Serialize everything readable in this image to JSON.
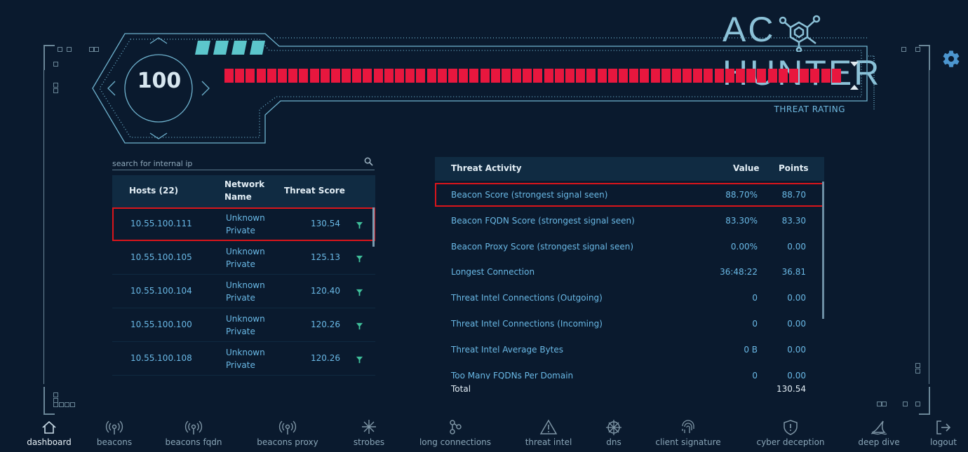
{
  "logo": {
    "left_text": "AC",
    "right_text": "HUNTER"
  },
  "gauge": {
    "value": "100",
    "label": "THREAT RATING",
    "level": 1.0
  },
  "search": {
    "placeholder": "search for internal ip"
  },
  "hosts": {
    "headers": {
      "hosts": "Hosts (22)",
      "network": "Network Name",
      "score": "Threat Score"
    },
    "rows": [
      {
        "ip": "10.55.100.111",
        "network": "Unknown Private",
        "score": "130.54",
        "selected": true
      },
      {
        "ip": "10.55.100.105",
        "network": "Unknown Private",
        "score": "125.13"
      },
      {
        "ip": "10.55.100.104",
        "network": "Unknown Private",
        "score": "120.40"
      },
      {
        "ip": "10.55.100.100",
        "network": "Unknown Private",
        "score": "120.26"
      },
      {
        "ip": "10.55.100.108",
        "network": "Unknown Private",
        "score": "120.26"
      }
    ]
  },
  "threat_activity": {
    "headers": {
      "activity": "Threat Activity",
      "value": "Value",
      "points": "Points"
    },
    "rows": [
      {
        "label": "Beacon Score (strongest signal seen)",
        "value": "88.70%",
        "points": "88.70",
        "selected": true
      },
      {
        "label": "Beacon FQDN Score (strongest signal seen)",
        "value": "83.30%",
        "points": "83.30"
      },
      {
        "label": "Beacon Proxy Score (strongest signal seen)",
        "value": "0.00%",
        "points": "0.00"
      },
      {
        "label": "Longest Connection",
        "value": "36:48:22",
        "points": "36.81"
      },
      {
        "label": "Threat Intel Connections (Outgoing)",
        "value": "0",
        "points": "0.00"
      },
      {
        "label": "Threat Intel Connections (Incoming)",
        "value": "0",
        "points": "0.00"
      },
      {
        "label": "Threat Intel Average Bytes",
        "value": "0 B",
        "points": "0.00"
      },
      {
        "label": "Too Many FQDNs Per Domain",
        "value": "0",
        "points": "0.00"
      }
    ],
    "total": {
      "label": "Total",
      "points": "130.54"
    }
  },
  "nav": [
    {
      "label": "dashboard",
      "icon": "home-icon",
      "active": true
    },
    {
      "label": "beacons",
      "icon": "broadcast-icon"
    },
    {
      "label": "beacons fqdn",
      "icon": "broadcast-icon"
    },
    {
      "label": "beacons proxy",
      "icon": "broadcast-icon"
    },
    {
      "label": "strobes",
      "icon": "starburst-icon"
    },
    {
      "label": "long connections",
      "icon": "nodes-icon"
    },
    {
      "label": "threat intel",
      "icon": "warning-icon"
    },
    {
      "label": "dns",
      "icon": "compass-icon"
    },
    {
      "label": "client signature",
      "icon": "fingerprint-icon"
    },
    {
      "label": "cyber deception",
      "icon": "shield-icon"
    },
    {
      "label": "deep dive",
      "icon": "shark-fin-icon"
    },
    {
      "label": "logout",
      "icon": "logout-icon"
    }
  ],
  "colors": {
    "background": "#0a1a2e",
    "accent": "#6ab9e6",
    "threat": "#e8173e",
    "teal": "#5cc6cc",
    "highlight": "#d9151b"
  }
}
